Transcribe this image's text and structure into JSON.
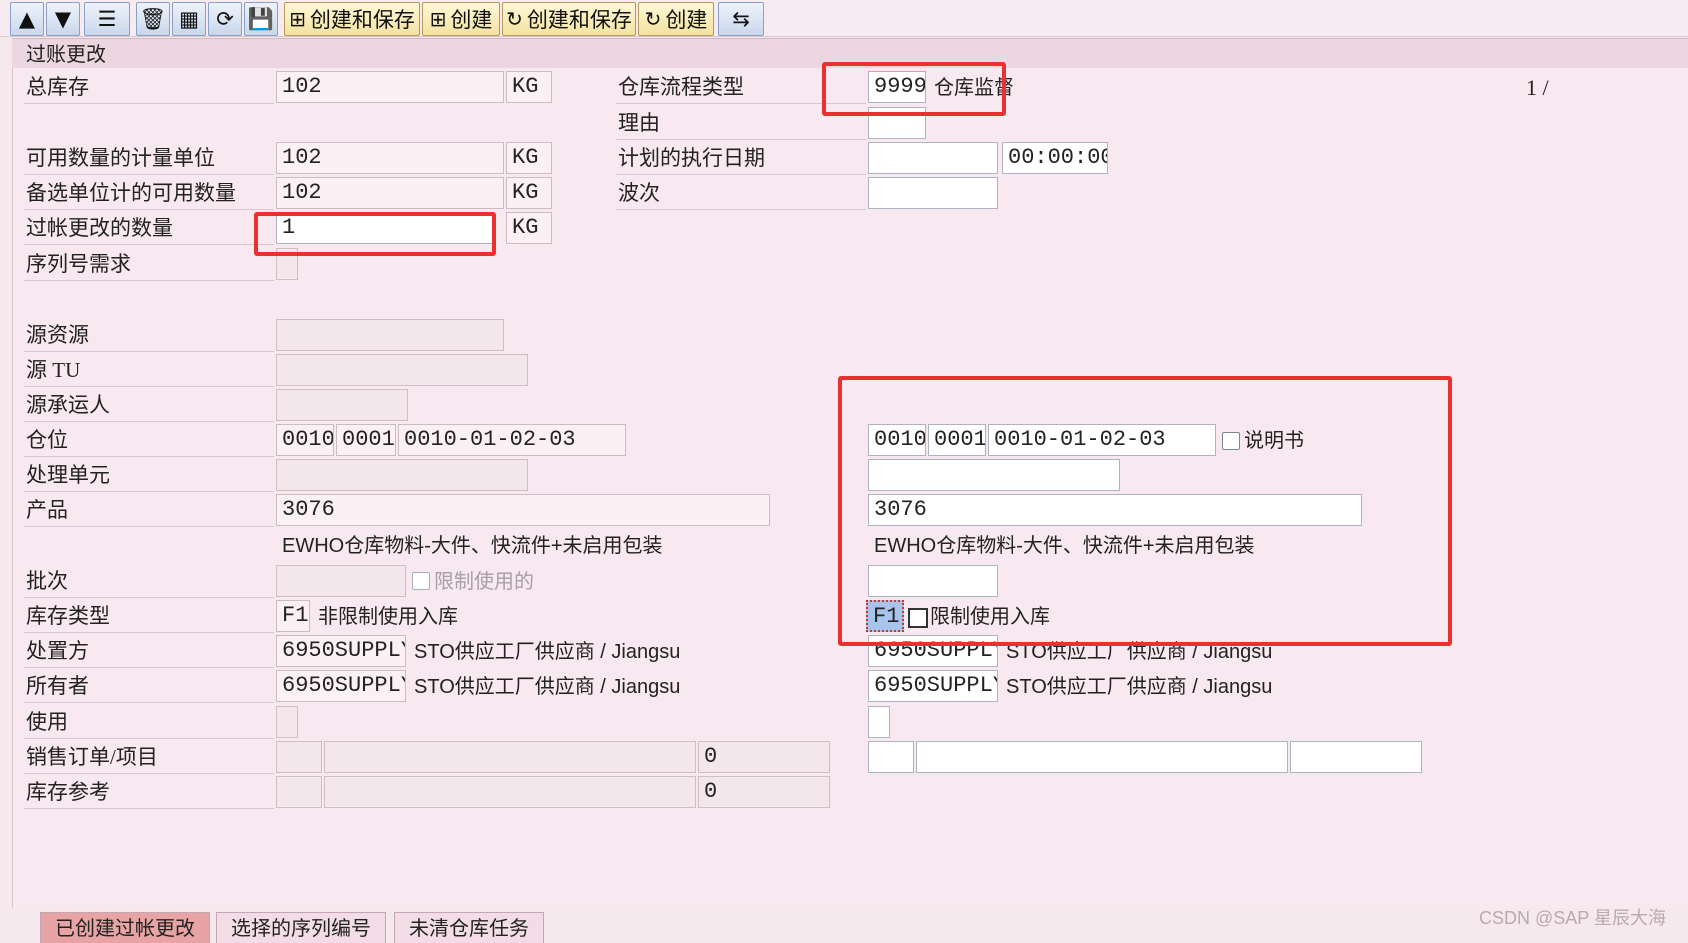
{
  "toolbar": {
    "create_save_1": "创建和保存",
    "create_1": "创建",
    "create_save_2": "创建和保存",
    "create_2": "创建"
  },
  "section_title": "过账更改",
  "page_indicator": "1 /",
  "left": {
    "total_stock": {
      "label": "总库存",
      "value": "102",
      "unit": "KG"
    },
    "avail_qty_uom": {
      "label": "可用数量的计量单位",
      "value": "102",
      "unit": "KG"
    },
    "avail_qty_alt": {
      "label": "备选单位计的可用数量",
      "value": "102",
      "unit": "KG"
    },
    "posting_change_qty": {
      "label": "过帐更改的数量",
      "value": "1",
      "unit": "KG"
    },
    "serial_req": {
      "label": "序列号需求"
    },
    "src_resource": {
      "label": "源资源",
      "value": ""
    },
    "src_tu": {
      "label": "源 TU",
      "value": ""
    },
    "src_carrier": {
      "label": "源承运人",
      "value": ""
    },
    "storage_bin": {
      "label": "仓位",
      "v1": "0010",
      "v2": "0001",
      "v3": "0010-01-02-03"
    },
    "handling_unit": {
      "label": "处理单元",
      "value": ""
    },
    "product": {
      "label": "产品",
      "value": "3076",
      "desc": "EWHO仓库物料-大件、快流件+未启用包装"
    },
    "batch": {
      "label": "批次",
      "value": "",
      "restricted": "限制使用的"
    },
    "stock_type": {
      "label": "库存类型",
      "value": "F1",
      "desc": "非限制使用入库"
    },
    "disposal": {
      "label": "处置方",
      "value": "6950SUPPLY",
      "desc": "STO供应工厂供应商 / Jiangsu"
    },
    "owner": {
      "label": "所有者",
      "value": "6950SUPPLY",
      "desc": "STO供应工厂供应商 / Jiangsu"
    },
    "usage": {
      "label": "使用",
      "value": ""
    },
    "sales_order": {
      "label": "销售订单/项目",
      "v1": "",
      "v2": "",
      "v3": "0"
    },
    "stock_ref": {
      "label": "库存参考",
      "v1": "",
      "v2": "",
      "v3": "0"
    }
  },
  "mid": {
    "process_type": {
      "label": "仓库流程类型",
      "value": "9999",
      "desc": "仓库监督"
    },
    "reason": {
      "label": "理由",
      "value": ""
    },
    "planned_date": {
      "label": "计划的执行日期",
      "value": "",
      "time": "00:00:00"
    },
    "wave": {
      "label": "波次",
      "value": ""
    }
  },
  "dest": {
    "storage_bin": {
      "v1": "0010",
      "v2": "0001",
      "v3": "0010-01-02-03",
      "manual_label": "说明书"
    },
    "handling_unit": "",
    "product": "3076",
    "product_desc": "EWHO仓库物料-大件、快流件+未启用包装",
    "batch": "",
    "stock_type": "F1",
    "stock_type_desc": "限制使用入库",
    "disposal": "6950SUPPLY",
    "disposal_desc": "STO供应工厂供应商 / Jiangsu",
    "owner": "6950SUPPLY",
    "owner_desc": "STO供应工厂供应商 / Jiangsu"
  },
  "tabs": [
    "已创建过帐更改",
    "选择的序列编号",
    "未清仓库任务"
  ],
  "watermark": "CSDN @SAP 星辰大海",
  "colors": {
    "highlight": "#e8322f",
    "background": "#f8e8ef"
  }
}
